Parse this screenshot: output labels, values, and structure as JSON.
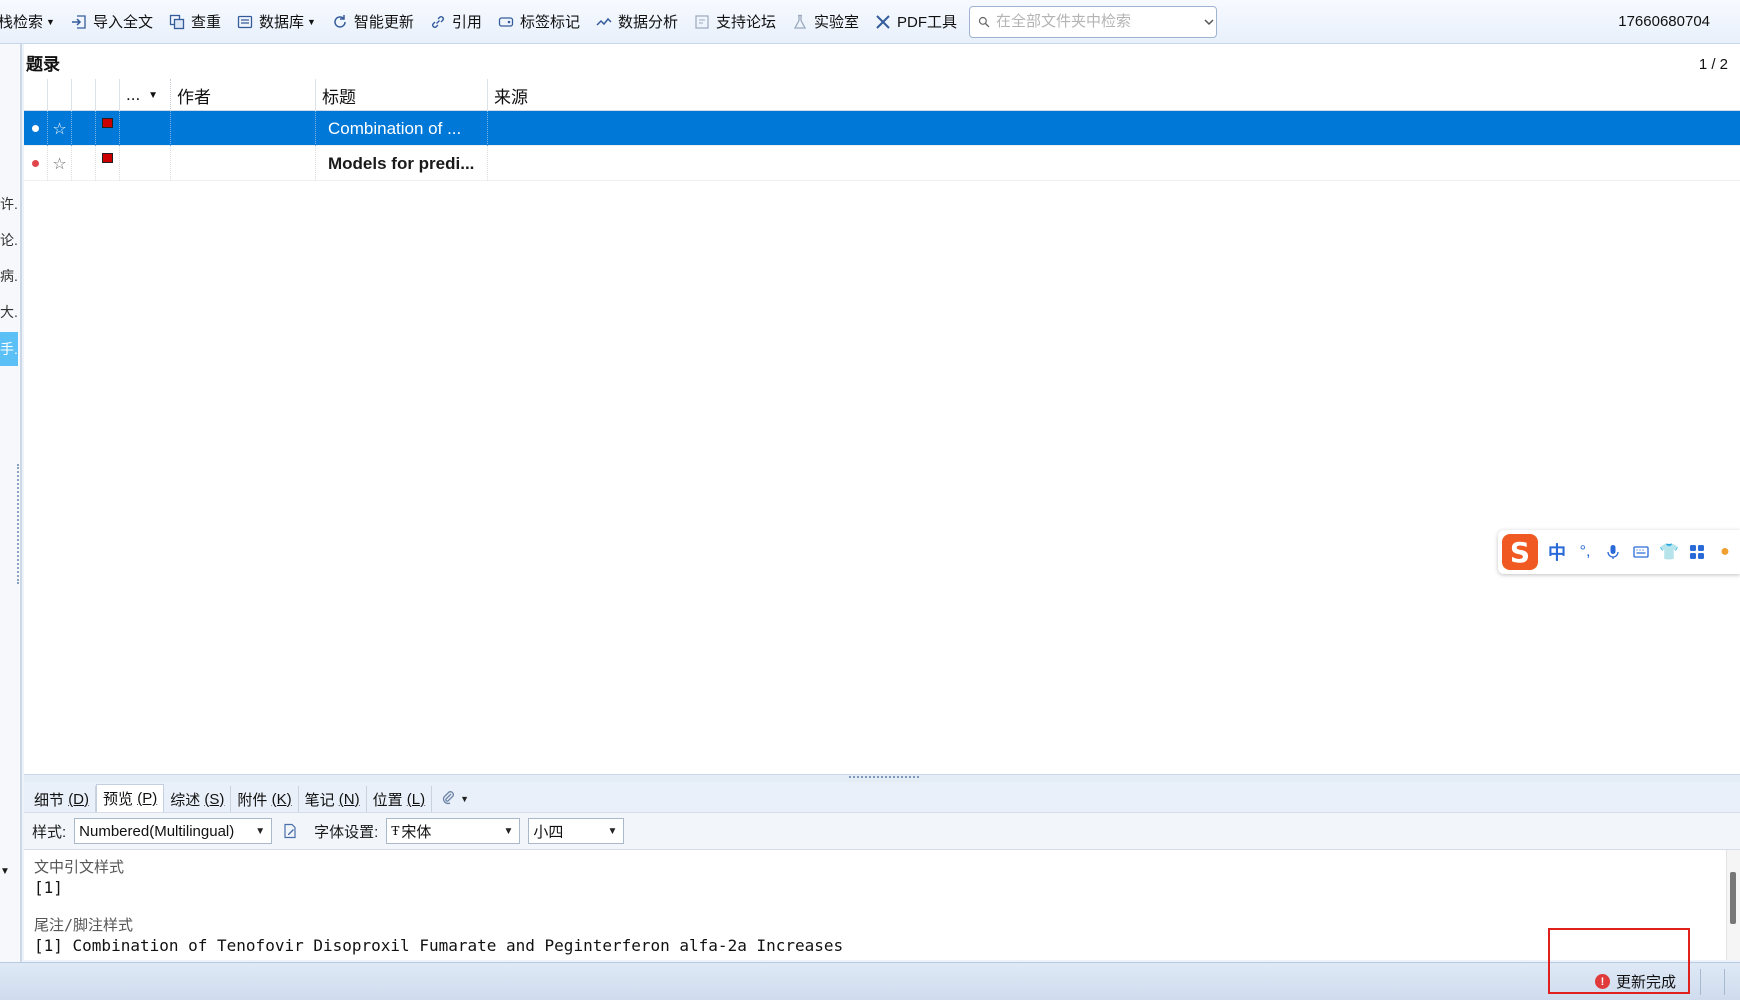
{
  "toolbar": {
    "items": [
      {
        "label": "栈检索",
        "has_caret": true
      },
      {
        "label": "导入全文"
      },
      {
        "label": "查重"
      },
      {
        "label": "数据库",
        "has_caret": true
      },
      {
        "label": "智能更新"
      },
      {
        "label": "引用"
      },
      {
        "label": "标签标记"
      },
      {
        "label": "数据分析"
      },
      {
        "label": "支持论坛"
      },
      {
        "label": "实验室"
      },
      {
        "label": "PDF工具"
      }
    ],
    "search_placeholder": "在全部文件夹中检索",
    "user_id": "17660680704"
  },
  "left_strip": {
    "fragments": [
      "许...",
      "论...",
      "病...",
      "大...",
      "手..."
    ],
    "selected_index": 4
  },
  "list": {
    "title": "题录",
    "pager": "1 / 2",
    "columns": {
      "col4": "...",
      "author": "作者",
      "title": "标题",
      "source": "来源"
    },
    "rows": [
      {
        "title": "Combination of ...",
        "selected": true
      },
      {
        "title": "Models for predi...",
        "selected": false,
        "bold": true
      }
    ]
  },
  "tabs": [
    {
      "label": "细节",
      "key": "(D)"
    },
    {
      "label": "预览",
      "key": "(P)",
      "active": true
    },
    {
      "label": "综述",
      "key": "(S)"
    },
    {
      "label": "附件",
      "key": "(K)"
    },
    {
      "label": "笔记",
      "key": "(N)"
    },
    {
      "label": "位置",
      "key": "(L)"
    }
  ],
  "stylebar": {
    "style_label": "样式:",
    "style_value": "Numbered(Multilingual)",
    "font_label": "字体设置:",
    "font_value": "宋体",
    "size_value": "小四"
  },
  "preview": {
    "in_text_label": "文中引文样式",
    "in_text_value": "[1]",
    "footnote_label": "尾注/脚注样式",
    "footnote_value": "[1]   Combination of Tenofovir Disoproxil Fumarate and Peginterferon alfa-2a Increases"
  },
  "status": {
    "message": "更新完成"
  },
  "ime": {
    "char": "中"
  },
  "colors": {
    "selection": "#0078d7",
    "highlight_box": "#e0201c",
    "ime_logo": "#f05a22"
  }
}
